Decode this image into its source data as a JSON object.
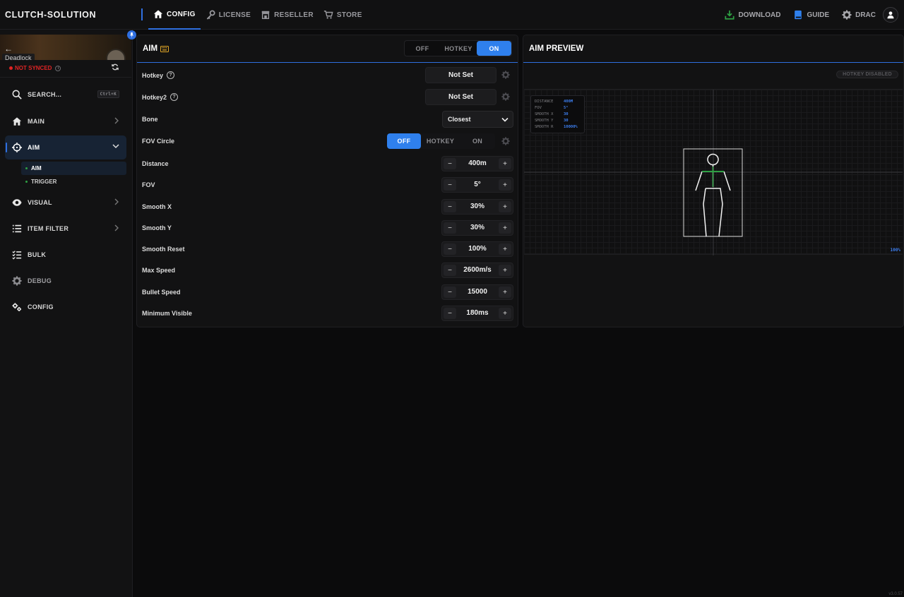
{
  "app": {
    "brand": "CLUTCH-SOLUTION",
    "version": "v3.0.57"
  },
  "topnav": {
    "items": [
      {
        "label": "CONFIG",
        "icon": "home-icon",
        "active": true
      },
      {
        "label": "LICENSE",
        "icon": "key-icon",
        "active": false
      },
      {
        "label": "RESELLER",
        "icon": "store-icon",
        "active": false
      },
      {
        "label": "STORE",
        "icon": "cart-icon",
        "active": false
      }
    ],
    "right": {
      "download": "DOWNLOAD",
      "guide": "GUIDE",
      "user": "DRAC"
    }
  },
  "sidebar": {
    "game_label": "Deadlock",
    "sync_status": "NOT SYNCED",
    "search": {
      "label": "SEARCH...",
      "shortcut": "Ctrl+K"
    },
    "items": [
      {
        "label": "MAIN",
        "icon": "home-icon"
      },
      {
        "label": "AIM",
        "icon": "crosshair-icon",
        "active": true
      },
      {
        "label": "VISUAL",
        "icon": "eye-icon"
      },
      {
        "label": "ITEM FILTER",
        "icon": "list-icon"
      },
      {
        "label": "BULK",
        "icon": "checklist-icon"
      },
      {
        "label": "DEBUG",
        "icon": "gear-icon"
      },
      {
        "label": "CONFIG",
        "icon": "gears-icon"
      }
    ],
    "sub_items": [
      {
        "label": "AIM",
        "active": true
      },
      {
        "label": "TRIGGER",
        "active": false
      }
    ]
  },
  "aim_panel": {
    "title": "AIM",
    "mode": {
      "options": [
        "OFF",
        "HOTKEY",
        "ON"
      ],
      "selected": "ON"
    },
    "hotkey": {
      "label": "Hotkey",
      "value": "Not Set"
    },
    "hotkey2": {
      "label": "Hotkey2",
      "value": "Not Set"
    },
    "bone": {
      "label": "Bone",
      "value": "Closest"
    },
    "fov_circle": {
      "label": "FOV Circle",
      "options": [
        "OFF",
        "HOTKEY",
        "ON"
      ],
      "selected": "OFF"
    },
    "steppers": [
      {
        "label": "Distance",
        "value": "400m"
      },
      {
        "label": "FOV",
        "value": "5°"
      },
      {
        "label": "Smooth X",
        "value": "30%"
      },
      {
        "label": "Smooth Y",
        "value": "30%"
      },
      {
        "label": "Smooth Reset",
        "value": "100%"
      },
      {
        "label": "Max Speed",
        "value": "2600m/s"
      },
      {
        "label": "Bullet Speed",
        "value": "15000"
      },
      {
        "label": "Minimum Visible",
        "value": "180ms"
      }
    ],
    "minus_symbol": "−",
    "plus_symbol": "+"
  },
  "preview_panel": {
    "title": "AIM PREVIEW",
    "hotkey_badge": "HOTKEY DISABLED",
    "stats": [
      {
        "key": "DISTANCE",
        "value": "400M"
      },
      {
        "key": "FOV",
        "value": "5°"
      },
      {
        "key": "SMOOTH X",
        "value": "30"
      },
      {
        "key": "SMOOTH Y",
        "value": "30"
      },
      {
        "key": "SMOOTH R",
        "value": "10000%"
      }
    ],
    "zoom": "100%"
  },
  "colors": {
    "accent": "#2f80ed",
    "danger": "#e02424",
    "success": "#2ea043",
    "warning": "#e0a526"
  }
}
